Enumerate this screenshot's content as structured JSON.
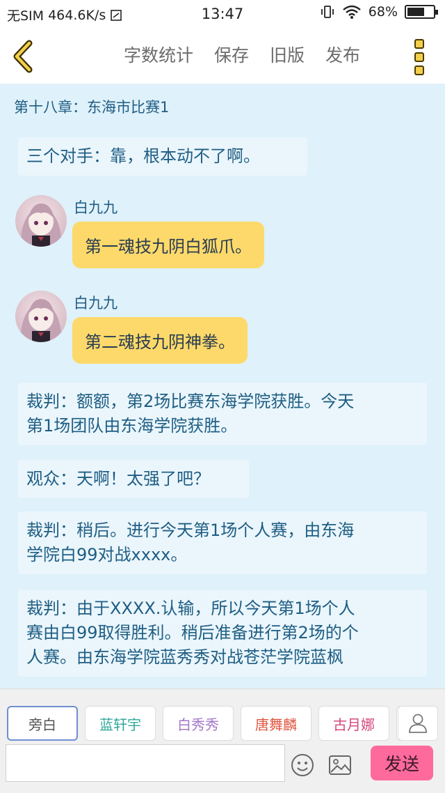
{
  "status_bar": {
    "carrier": "无SIM",
    "speed": "464.6K/s",
    "time": "13:47",
    "battery": "68%",
    "battery_level": 0.68
  },
  "toolbar": {
    "word_count": "字数统计",
    "save": "保存",
    "old_version": "旧版",
    "publish": "发布"
  },
  "chapter": {
    "title": "第十八章：东海市比赛1"
  },
  "messages": {
    "m1": "三个对手：靠，根本动不了啊。",
    "m2": {
      "name": "白九九",
      "text": "第一魂技九阴白狐爪。"
    },
    "m3": {
      "name": "白九九",
      "text": "第二魂技九阴神拳。"
    },
    "m4": {
      "line1": "裁判：额额，第2场比赛东海学院获胜。今天",
      "line2": "第1场团队由东海学院获胜。"
    },
    "m5": "观众：天啊！太强了吧？",
    "m6": {
      "line1": "裁判：稍后。进行今天第1场个人赛，由东海",
      "line2": "学院白99对战xxxx。"
    },
    "m7": {
      "line1": "裁判：由于XXXX.认输，所以今天第1场个人",
      "line2": "赛由白99取得胜利。稍后准备进行第2场的个",
      "line3": "人赛。由东海学院蓝秀秀对战苍茫学院蓝枫"
    }
  },
  "roles": [
    {
      "label": "旁白",
      "color": "#555555"
    },
    {
      "label": "蓝轩宇",
      "color": "#2ea79a"
    },
    {
      "label": "白秀秀",
      "color": "#a277c9"
    },
    {
      "label": "唐舞麟",
      "color": "#e0563f"
    },
    {
      "label": "古月娜",
      "color": "#d6487e"
    }
  ],
  "composer": {
    "placeholder": "",
    "send_label": "发送"
  },
  "colors": {
    "background": "#dff1fa",
    "bubble": "#fcd96a",
    "text_blue": "#1f5d83",
    "send_button": "#ff6a9d"
  }
}
